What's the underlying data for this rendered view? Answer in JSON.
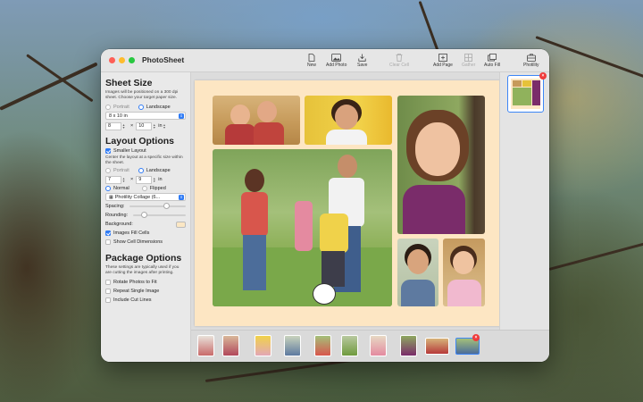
{
  "window": {
    "title": "PhotoSheet"
  },
  "toolbar": {
    "new": "New",
    "add_photo": "Add Photo",
    "save": "Save",
    "clear_cell": "Clear Cell",
    "add_page": "Add Page",
    "gather": "Gather",
    "auto_fill": "Auto Fill",
    "photility": "Photility"
  },
  "sidebar": {
    "sheet_size": {
      "title": "Sheet Size",
      "hint": "Images will be positioned on a 300 dpi sheet. Choose your target paper size.",
      "portrait": "Portrait",
      "landscape": "Landscape",
      "paper": "8 x 10 in",
      "width": "8",
      "times": "×",
      "height": "10",
      "unit": "in"
    },
    "layout_options": {
      "title": "Layout Options",
      "smaller_layout": "Smaller Layout",
      "hint": "Center the layout at a specific size within the sheet.",
      "portrait": "Portrait",
      "landscape": "Landscape",
      "width": "7",
      "times": "×",
      "height": "9",
      "unit": "in",
      "normal": "Normal",
      "flipped": "Flipped",
      "template": "Photility Collage (6...",
      "spacing": "Spacing:",
      "rounding": "Rounding:",
      "background": "Background:",
      "images_fill_cells": "Images Fill Cells",
      "show_cell_dimensions": "Show Cell Dimensions"
    },
    "package_options": {
      "title": "Package Options",
      "hint": "These settings are typically used if you are cutting the images after printing.",
      "rotate": "Rotate Photos to Fit",
      "repeat": "Repeat Single Image",
      "cut_lines": "Include Cut Lines"
    }
  },
  "pages": {
    "remove_badge": "×"
  },
  "filmstrip": {
    "remove_badge": "×"
  },
  "colors": {
    "accent": "#2f7bf5",
    "sheet_background": "#fde6c3",
    "badge": "#ef3b3b"
  }
}
